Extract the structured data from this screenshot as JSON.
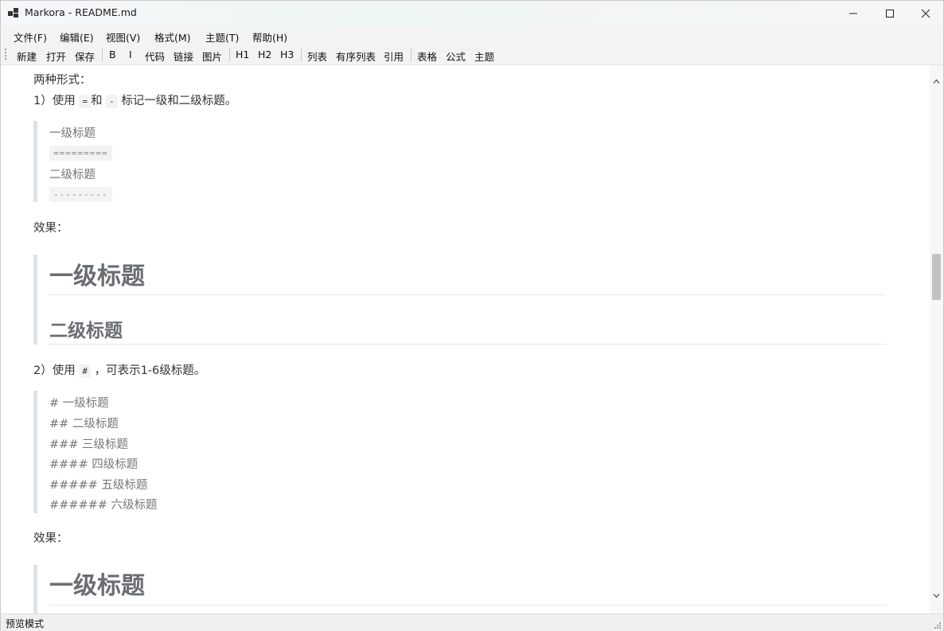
{
  "window": {
    "title": "Markora - README.md"
  },
  "menu": [
    "文件(F)",
    "编辑(E)",
    "视图(V)",
    "格式(M)",
    "主题(T)",
    "帮助(H)"
  ],
  "toolbar": {
    "new": "新建",
    "open": "打开",
    "save": "保存",
    "bold": "B",
    "italic": "I",
    "code": "代码",
    "link": "链接",
    "image": "图片",
    "h1": "H1",
    "h2": "H2",
    "h3": "H3",
    "list": "列表",
    "ordered_list": "有序列表",
    "quote": "引用",
    "table": "表格",
    "formula": "公式",
    "theme": "主题"
  },
  "doc": {
    "intro": "两种形式：",
    "item1_prefix": "1）使用",
    "item1_eq": "=",
    "item1_and": "和",
    "item1_dash": "-",
    "item1_suffix": "标记一级和二级标题。",
    "bq1_line1": "一级标题",
    "bq1_code1": "=========",
    "bq1_line2": "二级标题",
    "bq1_code2": "---------",
    "effect1": "效果：",
    "demo_h1": "一级标题",
    "demo_h2": "二级标题",
    "item2_prefix": "2）使用",
    "item2_hash": "#",
    "item2_suffix": "，可表示1-6级标题。",
    "bq2_lines": [
      "# 一级标题",
      "## 二级标题",
      "### 三级标题",
      "#### 四级标题",
      "##### 五级标题",
      "###### 六级标题"
    ],
    "effect2": "效果：",
    "demo2_h1": "一级标题"
  },
  "status": {
    "mode": "预览模式"
  }
}
